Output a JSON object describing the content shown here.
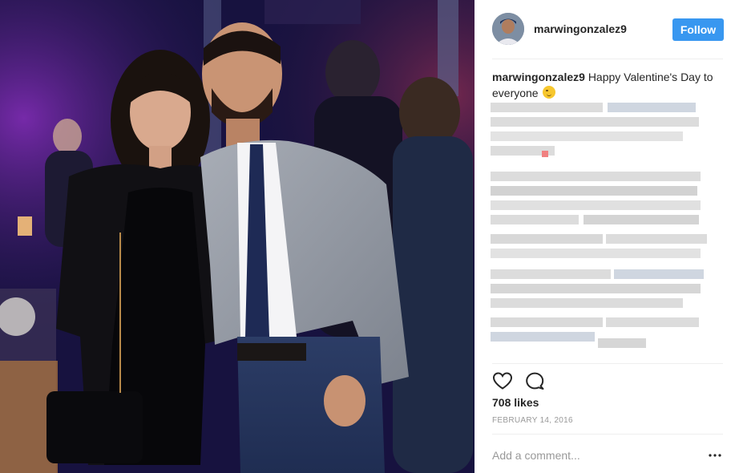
{
  "post": {
    "username": "marwingonzalez9",
    "follow_label": "Follow",
    "caption_user": "marwingonzalez9",
    "caption_text": "Happy Valentine's Day to everyone",
    "caption_emoji": "winking-face",
    "likes": "708 likes",
    "date": "February 14, 2016",
    "comment_placeholder": "Add a comment...",
    "image_alt": "Photo of a couple at an evening event"
  },
  "icons": {
    "like": "heart-outline-icon",
    "comment": "speech-bubble-icon",
    "more": "more-options-icon"
  },
  "colors": {
    "follow_button": "#3897f0",
    "text_primary": "#262626",
    "text_secondary": "#999999",
    "divider": "#efefef"
  }
}
